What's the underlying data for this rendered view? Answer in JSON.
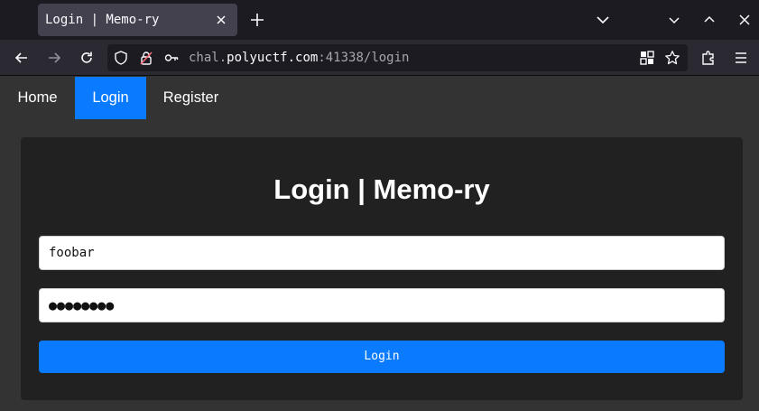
{
  "browser": {
    "tab": {
      "title": "Login | Memo-ry"
    },
    "url": {
      "prefix": "chal.",
      "host": "polyuctf.com",
      "suffix": ":41338/login"
    }
  },
  "site": {
    "nav": [
      {
        "label": "Home",
        "active": false
      },
      {
        "label": "Login",
        "active": true
      },
      {
        "label": "Register",
        "active": false
      }
    ]
  },
  "login": {
    "title": "Login | Memo-ry",
    "username": "foobar",
    "password_mask": "●●●●●●●●",
    "submit_label": "Login"
  },
  "colors": {
    "accent": "#0a7bff",
    "page_bg": "#333333",
    "card_bg": "#212121"
  }
}
